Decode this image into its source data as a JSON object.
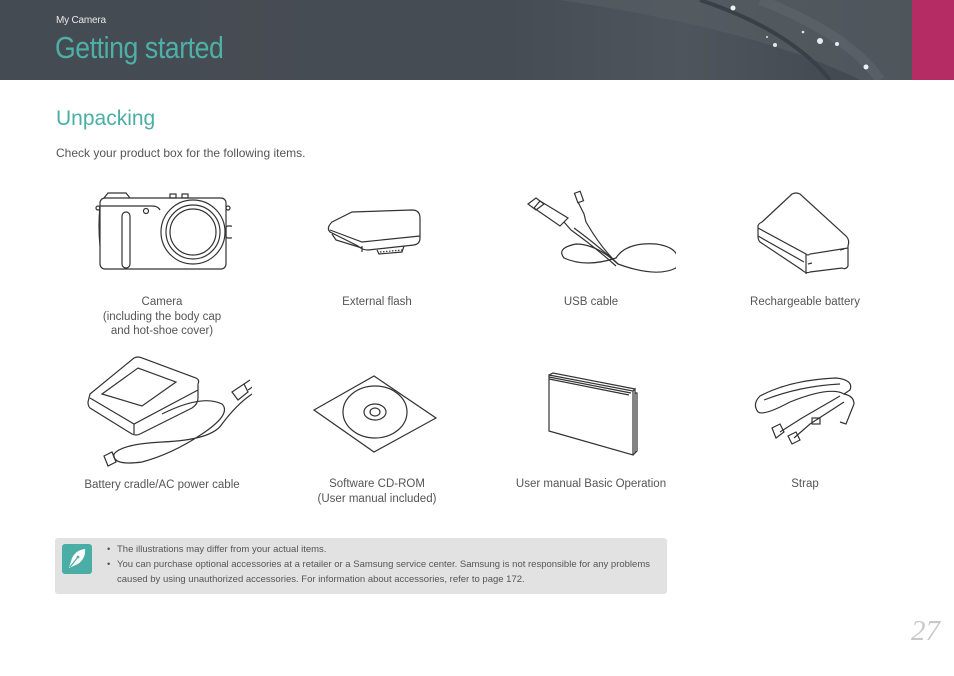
{
  "header": {
    "breadcrumb": "My Camera",
    "title": "Getting started",
    "accent_color": "#b52b63",
    "title_color": "#4db0a8"
  },
  "section": {
    "title": "Unpacking",
    "intro": "Check your product box for the following items."
  },
  "items": [
    {
      "icon": "camera-icon",
      "caption_lines": [
        "Camera",
        "(including the body cap",
        "and hot-shoe cover)"
      ]
    },
    {
      "icon": "external-flash-icon",
      "caption_lines": [
        "External flash"
      ]
    },
    {
      "icon": "usb-cable-icon",
      "caption_lines": [
        "USB cable"
      ]
    },
    {
      "icon": "battery-icon",
      "caption_lines": [
        "Rechargeable battery"
      ]
    },
    {
      "icon": "battery-cradle-icon",
      "caption_lines": [
        "Battery cradle/AC power cable"
      ]
    },
    {
      "icon": "cd-rom-icon",
      "caption_lines": [
        "Software CD-ROM",
        "(User manual included)"
      ]
    },
    {
      "icon": "user-manual-icon",
      "caption_lines": [
        "User manual Basic Operation"
      ]
    },
    {
      "icon": "strap-icon",
      "caption_lines": [
        "Strap"
      ]
    }
  ],
  "note": {
    "icon": "pen-nib-icon",
    "bullets": [
      "The illustrations may differ from your actual items.",
      "You can purchase optional accessories at a retailer or a Samsung service center. Samsung is not responsible for any problems caused by using unauthorized accessories. For information about accessories, refer to page 172."
    ]
  },
  "page_number": "27"
}
